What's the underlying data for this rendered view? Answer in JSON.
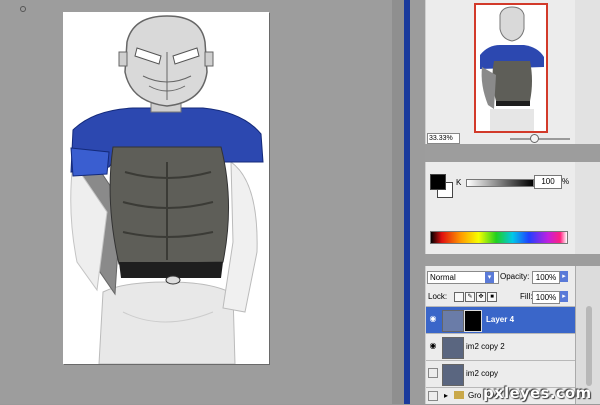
{
  "navigator": {
    "zoom": "33.33%"
  },
  "color": {
    "channel_label": "K",
    "channel_value": "100",
    "channel_unit": "%",
    "fg": "#000000",
    "bg": "#ffffff"
  },
  "layers": {
    "blend_mode": "Normal",
    "opacity_label": "Opacity:",
    "opacity_value": "100%",
    "lock_label": "Lock:",
    "fill_label": "Fill:",
    "fill_value": "100%",
    "items": [
      {
        "name": "Layer 4",
        "selected": true
      },
      {
        "name": "im2 copy 2",
        "selected": false
      },
      {
        "name": "im2 copy",
        "selected": false
      },
      {
        "name": "Gro",
        "selected": false
      }
    ]
  },
  "watermark": "pxleyes.com",
  "colors": {
    "accent": "#3a66c9",
    "nav_frame": "#d23a2a",
    "side_bar": "#1a3a9c"
  }
}
